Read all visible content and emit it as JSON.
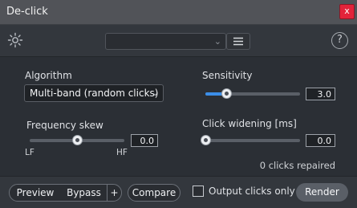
{
  "window": {
    "title": "De-click",
    "close_label": "x"
  },
  "toolbar": {
    "preset_value": "",
    "help_label": "?"
  },
  "algorithm": {
    "label": "Algorithm",
    "selected": "Multi-band (random clicks)"
  },
  "sensitivity": {
    "label": "Sensitivity",
    "value": "3.0",
    "level_fraction": 0.22
  },
  "frequency_skew": {
    "label": "Frequency skew",
    "value": "0.0",
    "level_fraction": 0.5,
    "min_label": "LF",
    "max_label": "HF"
  },
  "click_widening": {
    "label": "Click widening [ms]",
    "value": "0.0",
    "level_fraction": 0.0
  },
  "status": {
    "text": "0 clicks repaired"
  },
  "footer": {
    "preview_label": "Preview",
    "bypass_label": "Bypass",
    "plus_label": "+",
    "compare_label": "Compare",
    "output_clicks_label": "Output clicks only",
    "render_label": "Render"
  },
  "colors": {
    "accent": "#3b8ee8",
    "close": "#e2233a",
    "panel": "#2b2f35"
  },
  "icons": [
    "sun-icon",
    "chevron-down-icon",
    "hamburger-icon",
    "help-icon",
    "close-icon"
  ]
}
